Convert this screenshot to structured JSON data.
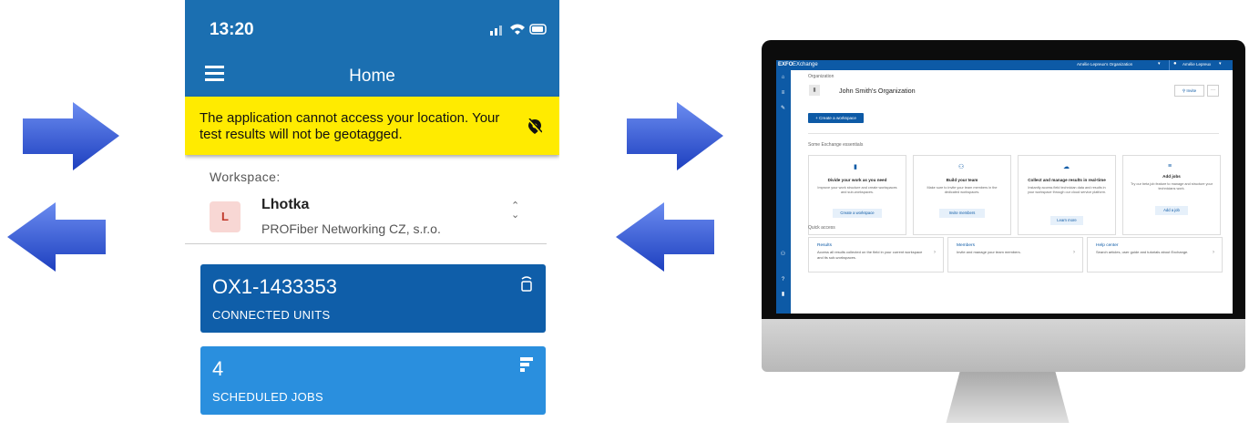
{
  "phone": {
    "time": "13:20",
    "title": "Home",
    "banner": "The application cannot access your location. Your test results will not be geotagged.",
    "workspace_label": "Workspace:",
    "workspace_avatar": "L",
    "workspace_name": "Lhotka",
    "workspace_org": "PROFiber Networking CZ, s.r.o.",
    "cards": [
      {
        "big": "OX1-1433353",
        "small": "CONNECTED UNITS",
        "icon": "unit-icon",
        "color": "#0f5ea9"
      },
      {
        "big": "4",
        "small": "SCHEDULED JOBS",
        "icon": "jobs-icon",
        "color": "#2a8fde"
      }
    ]
  },
  "exchange": {
    "logo": "EXFO",
    "logo_app": "EXchange",
    "org_selector": "Amélie Lepreux's Organization",
    "user": "Amélie Lepreux",
    "org_label": "Organization",
    "org_name": "John Smith's Organization",
    "invite": "Invite",
    "more": "···",
    "create_workspace": "+ Create a workspace",
    "essentials_heading": "Some Exchange essentials",
    "essentials": [
      {
        "title": "Divide your work as you need",
        "desc": "Improve your work structure and create workspaces and sub-workspaces.",
        "button": "Create a workspace",
        "icon": "building-icon"
      },
      {
        "title": "Build your team",
        "desc": "Make sure to invite your team members in the dedicated workspaces.",
        "button": "Invite members",
        "icon": "team-icon"
      },
      {
        "title": "Collect and manage results in real-time",
        "desc": "Instantly access field technician data and results in your workspace through our cloud service platform.",
        "button": "Learn more",
        "icon": "cloud-icon"
      },
      {
        "title": "Add jobs",
        "desc": "Try our beta job feature to manage and structure your technicians work.",
        "button": "Add a job",
        "icon": "jobs-icon"
      }
    ],
    "quick_heading": "Quick access",
    "quick": [
      {
        "title": "Results",
        "desc": "Access all results collected on the field in your current workspace and its sub-workspaces."
      },
      {
        "title": "Members",
        "desc": "Invite and manage your team members."
      },
      {
        "title": "Help center",
        "desc": "Search articles, user guide and tutorials about Exchange."
      }
    ]
  },
  "colors": {
    "brand_blue": "#1b6fb1",
    "banner_yellow": "#ffeb00",
    "arrow_blue": "#2f55d4"
  }
}
